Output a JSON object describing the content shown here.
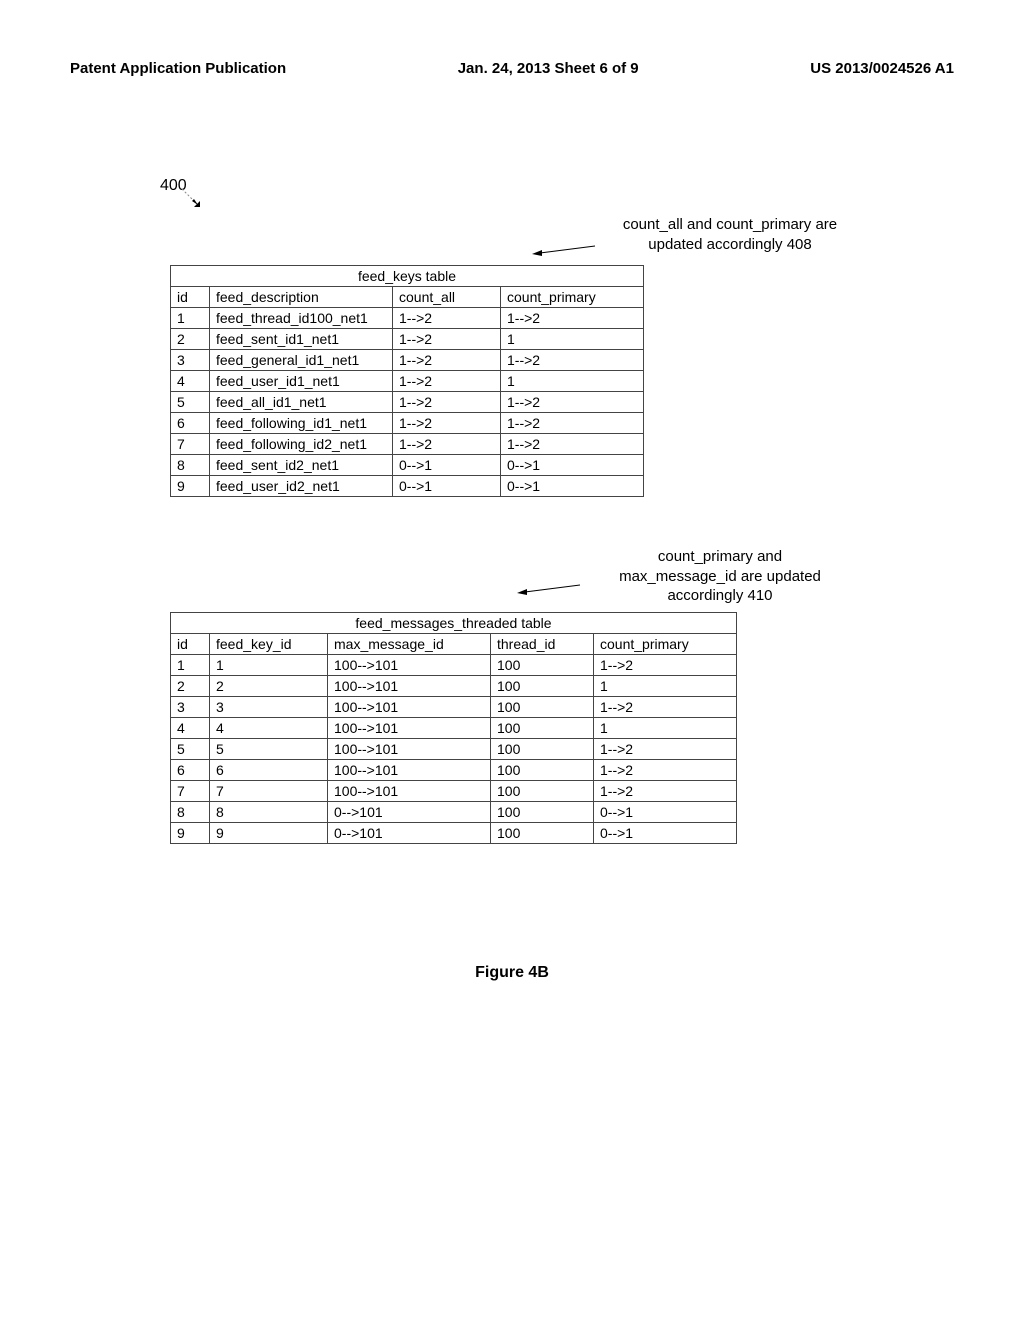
{
  "header": {
    "left": "Patent Application Publication",
    "center": "Jan. 24, 2013  Sheet 6 of 9",
    "right": "US 2013/0024526 A1"
  },
  "figure_ref": "400",
  "callout1_line1": "count_all and count_primary are",
  "callout1_line2": "updated accordingly 408",
  "callout2_line1": "count_primary and",
  "callout2_line2": "max_message_id are updated",
  "callout2_line3": "accordingly 410",
  "table1": {
    "title": "feed_keys table",
    "headers": [
      "id",
      "feed_description",
      "count_all",
      "count_primary"
    ],
    "rows": [
      [
        "1",
        "feed_thread_id100_net1",
        "1-->2",
        "1-->2"
      ],
      [
        "2",
        "feed_sent_id1_net1",
        "1-->2",
        "1"
      ],
      [
        "3",
        "feed_general_id1_net1",
        "1-->2",
        "1-->2"
      ],
      [
        "4",
        "feed_user_id1_net1",
        "1-->2",
        "1"
      ],
      [
        "5",
        "feed_all_id1_net1",
        "1-->2",
        "1-->2"
      ],
      [
        "6",
        "feed_following_id1_net1",
        "1-->2",
        "1-->2"
      ],
      [
        "7",
        "feed_following_id2_net1",
        "1-->2",
        "1-->2"
      ],
      [
        "8",
        "feed_sent_id2_net1",
        "0-->1",
        "0-->1"
      ],
      [
        "9",
        "feed_user_id2_net1",
        "0-->1",
        "0-->1"
      ]
    ]
  },
  "table2": {
    "title": "feed_messages_threaded table",
    "headers": [
      "id",
      "feed_key_id",
      "max_message_id",
      "thread_id",
      "count_primary"
    ],
    "rows": [
      [
        "1",
        "1",
        "100-->101",
        "100",
        "1-->2"
      ],
      [
        "2",
        "2",
        "100-->101",
        "100",
        "1"
      ],
      [
        "3",
        "3",
        "100-->101",
        "100",
        "1-->2"
      ],
      [
        "4",
        "4",
        "100-->101",
        "100",
        "1"
      ],
      [
        "5",
        "5",
        "100-->101",
        "100",
        "1-->2"
      ],
      [
        "6",
        "6",
        "100-->101",
        "100",
        "1-->2"
      ],
      [
        "7",
        "7",
        "100-->101",
        "100",
        "1-->2"
      ],
      [
        "8",
        "8",
        "0-->101",
        "100",
        "0-->1"
      ],
      [
        "9",
        "9",
        "0-->101",
        "100",
        "0-->1"
      ]
    ]
  },
  "caption": "Figure 4B"
}
